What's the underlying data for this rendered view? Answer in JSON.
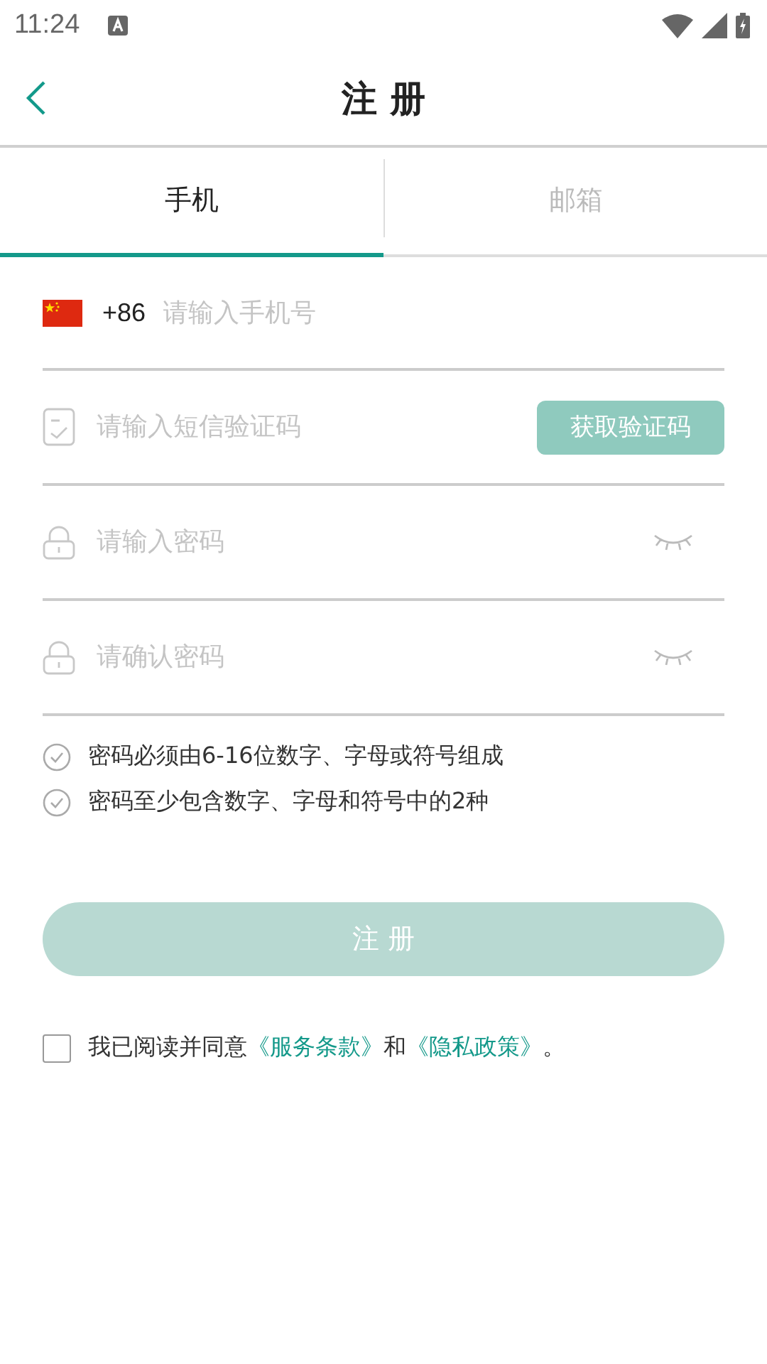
{
  "status_bar": {
    "time": "11:24"
  },
  "header": {
    "title": "注 册"
  },
  "tabs": [
    {
      "label": "手机",
      "selected": true
    },
    {
      "label": "邮箱",
      "selected": false
    }
  ],
  "fields": [
    {
      "kind": "phone",
      "prefix": "+86",
      "placeholder": "请输入手机号"
    },
    {
      "kind": "sms",
      "placeholder": "请输入短信验证码",
      "button": "获取验证码"
    },
    {
      "kind": "password",
      "placeholder": "请输入密码",
      "visible": false
    },
    {
      "kind": "password",
      "placeholder": "请确认密码",
      "visible": false
    }
  ],
  "rules": [
    "密码必须由6-16位数字、字母或符号组成",
    "密码至少包含数字、字母和符号中的2种"
  ],
  "submit": {
    "label": "注 册",
    "disabled": true
  },
  "agreement": {
    "checked": false,
    "text": "我已阅读并同意",
    "link_1": "《服务条款》",
    "joiner": "和",
    "link_2": "《隐私政策》",
    "end": "。"
  }
}
